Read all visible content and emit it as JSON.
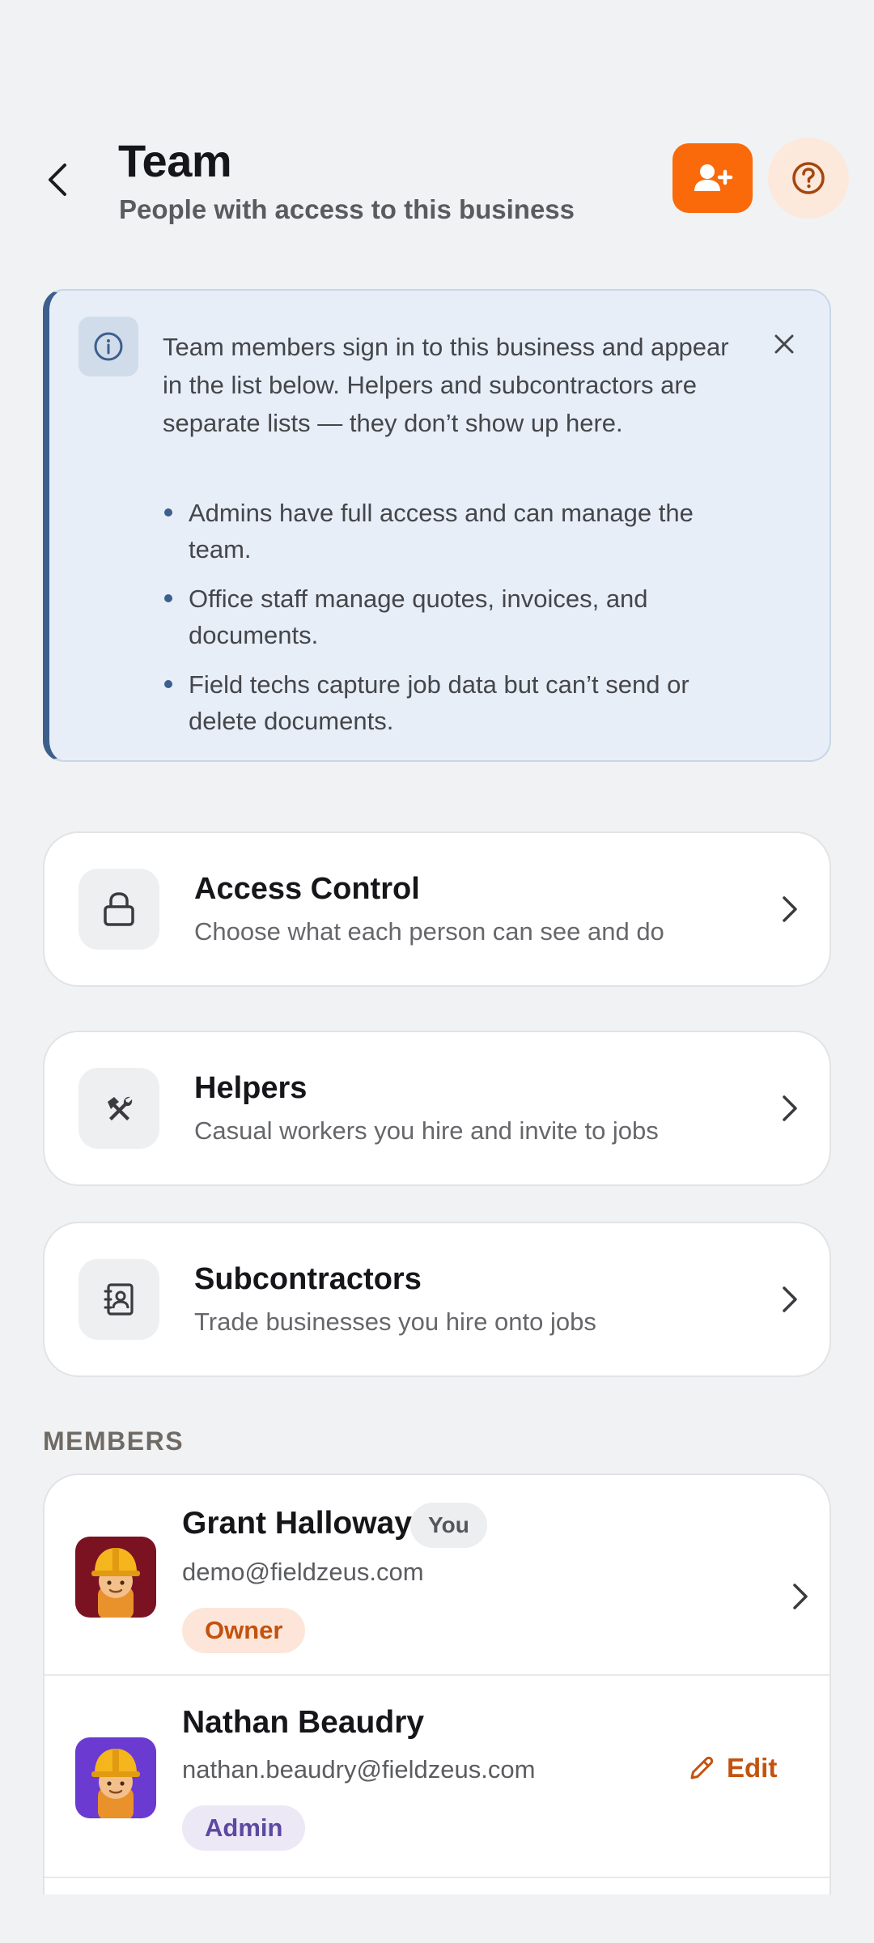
{
  "header": {
    "title": "Team",
    "subtitle": "People with access to this business"
  },
  "info_banner": {
    "text": "Team members sign in to this business and appear in the list below. Helpers and subcontractors are separate lists — they don’t show up here.",
    "bullets": [
      "Admins have full access and can manage the team.",
      "Office staff manage quotes, invoices, and documents.",
      "Field techs capture job data but can’t send or delete documents."
    ]
  },
  "nav_cards": [
    {
      "title": "Access Control",
      "description": "Choose what each person can see and do",
      "icon": "lock-icon"
    },
    {
      "title": "Helpers",
      "description": "Casual workers you hire and invite to jobs",
      "icon": "tools-icon"
    },
    {
      "title": "Subcontractors",
      "description": "Trade businesses you hire onto jobs",
      "icon": "contact-book-icon"
    }
  ],
  "members_section": {
    "label": "MEMBERS",
    "members": [
      {
        "name": "Grant Halloway",
        "you_label": "You",
        "email": "demo@fieldzeus.com",
        "role": "Owner",
        "avatar_bg": "#7a1222"
      },
      {
        "name": "Nathan Beaudry",
        "email": "nathan.beaudry@fieldzeus.com",
        "role": "Admin",
        "action": "Edit",
        "avatar_bg": "#6a3ad1"
      }
    ]
  },
  "colors": {
    "accent": "#fa6a0a",
    "info_border": "#3c5f8d",
    "owner_text": "#c2530f",
    "admin_text": "#5b4aa0"
  }
}
